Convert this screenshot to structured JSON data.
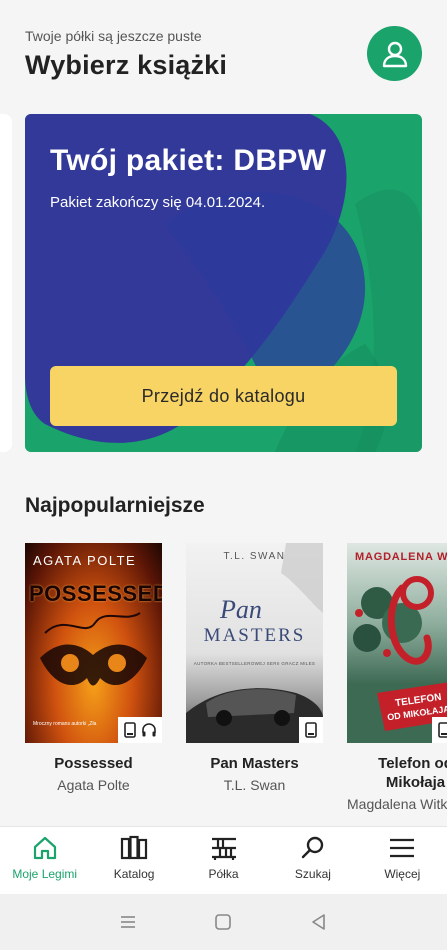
{
  "header": {
    "subtitle": "Twoje półki są jeszcze puste",
    "title": "Wybierz książki",
    "avatar_icon": "user-icon"
  },
  "package": {
    "title": "Twój pakiet: DBPW",
    "subtitle": "Pakiet zakończy się 04.01.2024.",
    "button_label": "Przejdź do katalogu",
    "colors": {
      "background": "#1aa36b",
      "shape": "#33349b",
      "button": "#f8d465"
    }
  },
  "section": {
    "title": "Najpopularniejsze"
  },
  "books": [
    {
      "title": "Possessed",
      "author": "Agata Polte",
      "cover_author": "AGATA POLTE",
      "cover_title": "POSSESSED",
      "cover_tagline": "Mroczny romans autorki „Zła",
      "formats": [
        "ebook-icon",
        "audiobook-icon"
      ]
    },
    {
      "title": "Pan Masters",
      "author": "T.L. Swan",
      "cover_author": "T.L. SWAN",
      "cover_title_1": "Pan",
      "cover_title_2": "MASTERS",
      "cover_tagline": "AUTORKA BESTSELLEROWEJ SERII GRACZ MILES",
      "formats": [
        "ebook-icon"
      ]
    },
    {
      "title": "Telefon od Mikołaja",
      "author": "Magdalena Witkiewicz",
      "cover_author": "MAGDALENA WITKIEWICZ",
      "cover_title_1": "TELEFON",
      "cover_title_2": "OD MIKOŁAJA",
      "formats": [
        "ebook-icon"
      ]
    }
  ],
  "nav": [
    {
      "label": "Moje Legimi",
      "icon": "home-icon",
      "active": true
    },
    {
      "label": "Katalog",
      "icon": "catalog-icon",
      "active": false
    },
    {
      "label": "Półka",
      "icon": "shelf-icon",
      "active": false
    },
    {
      "label": "Szukaj",
      "icon": "search-icon",
      "active": false
    },
    {
      "label": "Więcej",
      "icon": "menu-icon",
      "active": false
    }
  ]
}
